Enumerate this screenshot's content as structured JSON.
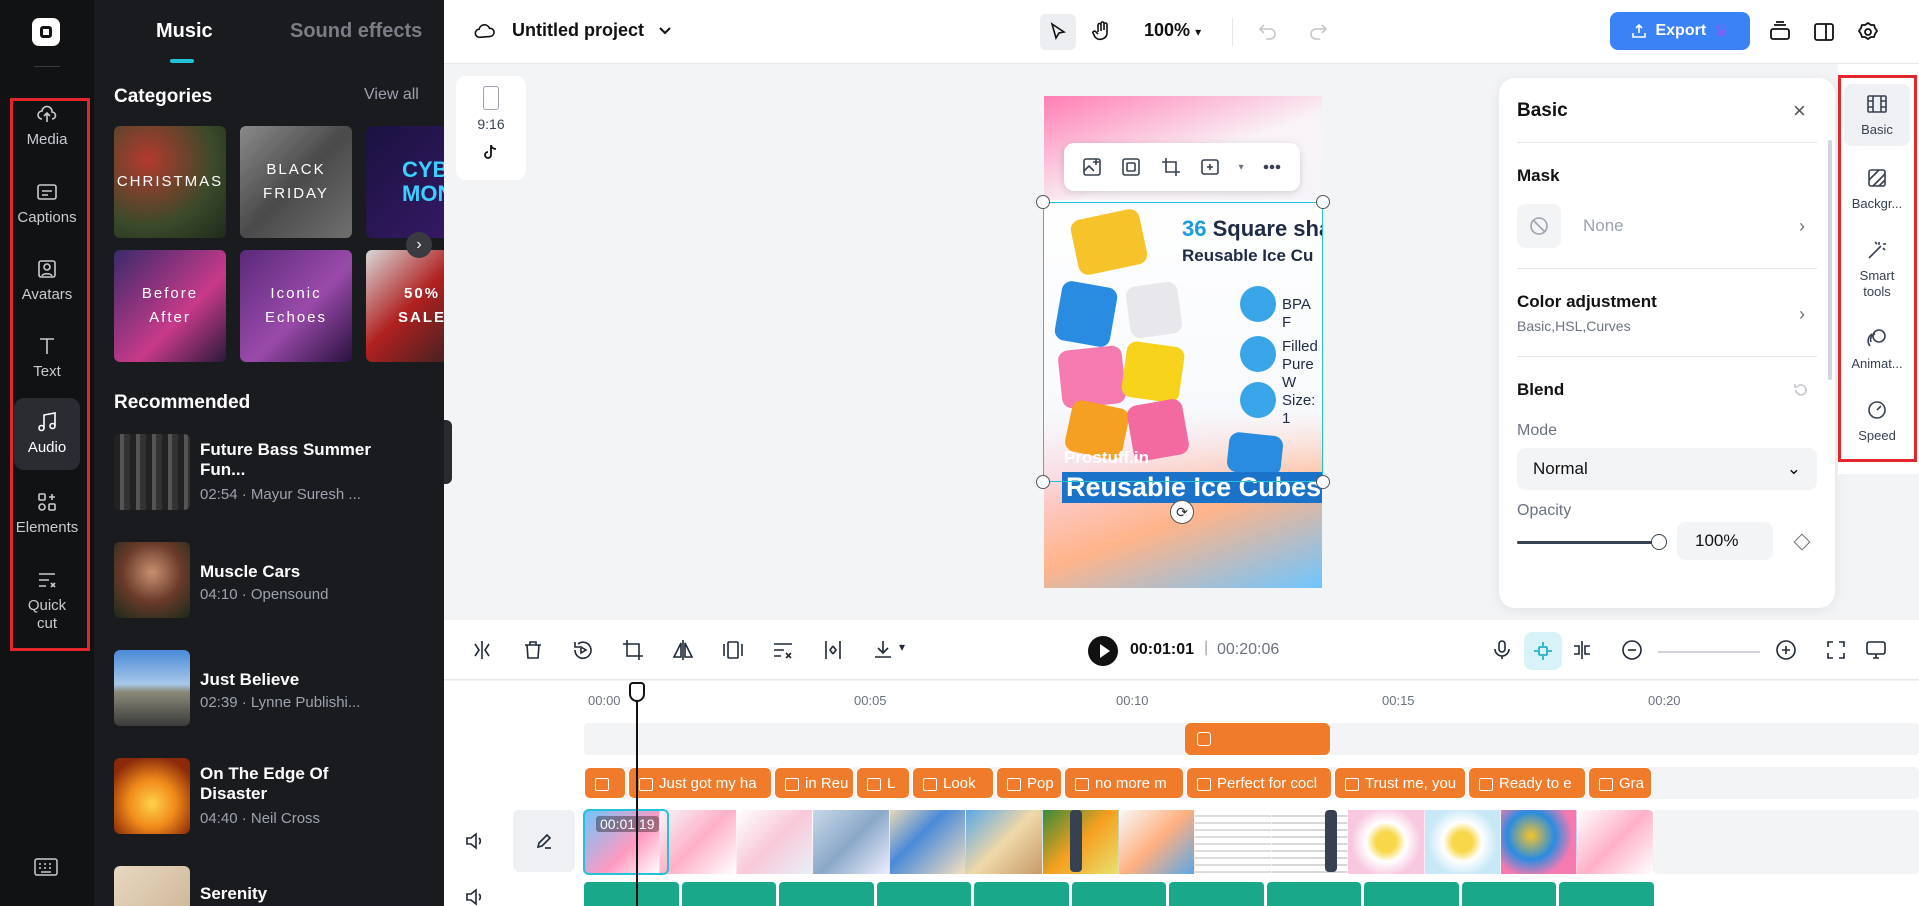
{
  "rail": {
    "items": [
      {
        "label": "Media",
        "icon": "cloud-upload-icon"
      },
      {
        "label": "Captions",
        "icon": "captions-icon"
      },
      {
        "label": "Avatars",
        "icon": "avatar-icon"
      },
      {
        "label": "Text",
        "icon": "text-icon"
      },
      {
        "label": "Audio",
        "icon": "music-note-icon"
      },
      {
        "label": "Elements",
        "icon": "elements-icon"
      },
      {
        "label": "Quick cut",
        "icon": "quick-cut-icon"
      }
    ]
  },
  "panel": {
    "tabs": [
      "Music",
      "Sound effects"
    ],
    "categories_title": "Categories",
    "view_all": "View all",
    "categories": [
      {
        "label": "CHRISTMAS"
      },
      {
        "label": "BLACK FRIDAY"
      },
      {
        "label": "CYBER MON"
      },
      {
        "label": "Before After"
      },
      {
        "label": "Iconic Echoes"
      },
      {
        "label": "50% SALE"
      }
    ],
    "recommended_title": "Recommended",
    "tracks": [
      {
        "name": "Future Bass Summer Fun...",
        "meta": "02:54 · Mayur Suresh ..."
      },
      {
        "name": "Muscle Cars",
        "meta": "04:10 · Opensound"
      },
      {
        "name": "Just Believe",
        "meta": "02:39 · Lynne Publishi..."
      },
      {
        "name": "On The Edge Of Disaster",
        "meta": "04:40 · Neil Cross"
      },
      {
        "name": "Serenity",
        "meta": ""
      }
    ]
  },
  "topbar": {
    "project_title": "Untitled project",
    "zoom": "100%",
    "export_label": "Export"
  },
  "canvas": {
    "ratio": "9:16",
    "preview": {
      "title_num": "36",
      "title_rest": " Square sha",
      "subtitle": "Reusable Ice Cu",
      "features": [
        "BPA F",
        "Filled",
        "Pure W",
        "Size: 1"
      ],
      "brand": "Prostuff.in",
      "caption": "Reusable Ice Cubes"
    }
  },
  "props": {
    "title": "Basic",
    "mask_label": "Mask",
    "mask_value": "None",
    "color_label": "Color adjustment",
    "color_sub": "Basic,HSL,Curves",
    "blend_label": "Blend",
    "mode_label": "Mode",
    "mode_value": "Normal",
    "opacity_label": "Opacity",
    "opacity_value": "100%",
    "opacity_level": 1.0
  },
  "side_tabs": [
    {
      "label": "Basic",
      "icon": "film-icon"
    },
    {
      "label": "Backgr...",
      "icon": "background-icon"
    },
    {
      "label": "Smart tools",
      "icon": "magic-wand-icon"
    },
    {
      "label": "Animat...",
      "icon": "animation-icon"
    },
    {
      "label": "Speed",
      "icon": "speed-icon"
    }
  ],
  "timeline": {
    "current_time": "00:01:01",
    "separator": "|",
    "total_time": "00:20:06",
    "ruler": [
      "00:00",
      "00:05",
      "00:10",
      "00:15",
      "00:20"
    ],
    "clip_timecode": "00:01:19",
    "captions": [
      "",
      "Just got my ha",
      "in Reu",
      "L",
      "Look",
      "Pop",
      "no more m",
      "Perfect for cocl",
      "Trust me, you",
      "Ready to e",
      "Gra"
    ]
  },
  "colors": {
    "accent": "#22c3d6",
    "export": "#3b82f6",
    "caption_clip": "#f07c2b",
    "audio_clip": "#1aa88a",
    "highlight": "#e3262c"
  }
}
